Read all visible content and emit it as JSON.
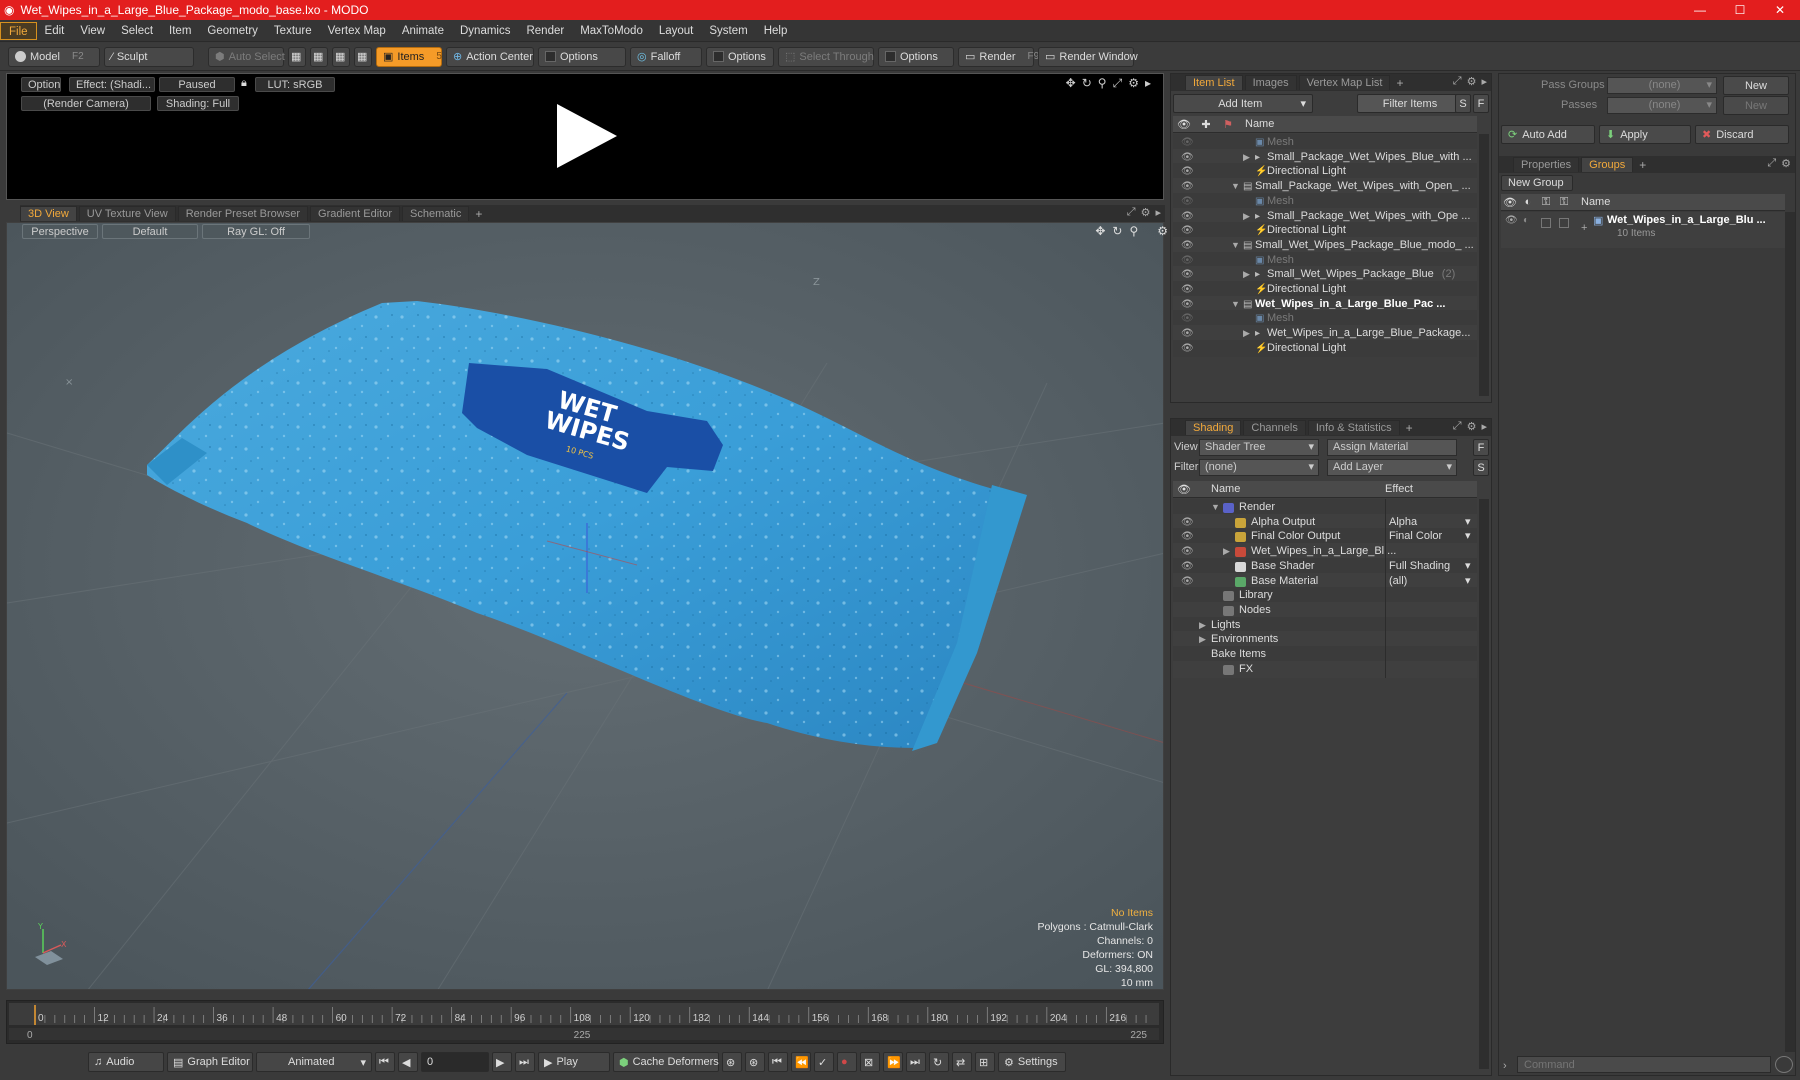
{
  "title": "Wet_Wipes_in_a_Large_Blue_Package_modo_base.lxo - MODO",
  "window_controls": {
    "minimize": "—",
    "maximize": "☐",
    "close": "✕"
  },
  "menu": [
    "File",
    "Edit",
    "View",
    "Select",
    "Item",
    "Geometry",
    "Texture",
    "Vertex Map",
    "Animate",
    "Dynamics",
    "Render",
    "MaxToModo",
    "Layout",
    "System",
    "Help"
  ],
  "toolbar": {
    "model": "Model",
    "model_key": "F2",
    "sculpt": "Sculpt",
    "auto_select": "Auto Select",
    "items": "Items",
    "items_key": "5",
    "action_center": "Action Center",
    "options1": "Options",
    "falloff": "Falloff",
    "options2": "Options",
    "select_through": "Select Through",
    "options3": "Options",
    "render": "Render",
    "render_key": "F9",
    "render_window": "Render Window"
  },
  "render_preview": {
    "options": "Options",
    "effect": "Effect: (Shadi...",
    "paused": "Paused",
    "lut": "LUT: sRGB",
    "camera": "(Render Camera)",
    "shading": "Shading: Full"
  },
  "viewport_tabs": [
    "3D View",
    "UV Texture View",
    "Render Preset Browser",
    "Gradient Editor",
    "Schematic"
  ],
  "viewport": {
    "perspective": "Perspective",
    "default": "Default",
    "raygl": "Ray GL: Off",
    "axis_label": "Z",
    "package_text_1": "WET",
    "package_text_2": "WIPES",
    "package_text_3": "10 PCS",
    "stats": {
      "no_items": "No Items",
      "polygons": "Polygons : Catmull-Clark",
      "channels": "Channels: 0",
      "deformers": "Deformers: ON",
      "gl": "GL: 394,800",
      "unit": "10 mm"
    }
  },
  "timeline": {
    "ticks": [
      "0",
      "12",
      "24",
      "36",
      "48",
      "60",
      "72",
      "84",
      "96",
      "108",
      "120",
      "132",
      "144",
      "156",
      "168",
      "180",
      "192",
      "204",
      "216"
    ],
    "start": "0",
    "mid": "225",
    "end": "225"
  },
  "transport": {
    "audio": "Audio",
    "graph_editor": "Graph Editor",
    "animated": "Animated",
    "frame": "0",
    "play": "Play",
    "cache_deformers": "Cache Deformers",
    "settings": "Settings"
  },
  "item_list": {
    "tabs": [
      "Item List",
      "Images",
      "Vertex Map List"
    ],
    "add_item": "Add Item",
    "filter": "Filter Items",
    "s_btn": "S",
    "f_btn": "F",
    "name_header": "Name",
    "rows": [
      {
        "label": "Mesh",
        "indent": 2,
        "kind": "mesh",
        "dim": true
      },
      {
        "label": "Small_Package_Wet_Wipes_Blue_with ...",
        "indent": 2,
        "kind": "group",
        "arrow": "▶"
      },
      {
        "label": "Directional Light",
        "indent": 2,
        "kind": "light"
      },
      {
        "label": "Small_Package_Wet_Wipes_with_Open_ ...",
        "indent": 1,
        "kind": "scene",
        "arrow": "▼"
      },
      {
        "label": "Mesh",
        "indent": 2,
        "kind": "mesh",
        "dim": true
      },
      {
        "label": "Small_Package_Wet_Wipes_with_Ope ...",
        "indent": 2,
        "kind": "group",
        "arrow": "▶"
      },
      {
        "label": "Directional Light",
        "indent": 2,
        "kind": "light"
      },
      {
        "label": "Small_Wet_Wipes_Package_Blue_modo_ ...",
        "indent": 1,
        "kind": "scene",
        "arrow": "▼"
      },
      {
        "label": "Mesh",
        "indent": 2,
        "kind": "mesh",
        "dim": true
      },
      {
        "label": "Small_Wet_Wipes_Package_Blue",
        "suffix": "(2)",
        "indent": 2,
        "kind": "group",
        "arrow": "▶"
      },
      {
        "label": "Directional Light",
        "indent": 2,
        "kind": "light"
      },
      {
        "label": "Wet_Wipes_in_a_Large_Blue_Pac ...",
        "indent": 1,
        "kind": "scene",
        "arrow": "▼",
        "bold": true
      },
      {
        "label": "Mesh",
        "indent": 2,
        "kind": "mesh",
        "dim": true
      },
      {
        "label": "Wet_Wipes_in_a_Large_Blue_Package...",
        "indent": 2,
        "kind": "group",
        "arrow": "▶"
      },
      {
        "label": "Directional Light",
        "indent": 2,
        "kind": "light"
      }
    ]
  },
  "shading": {
    "tabs": [
      "Shading",
      "Channels",
      "Info & Statistics"
    ],
    "view_label": "View",
    "view_value": "Shader Tree",
    "assign_material": "Assign Material",
    "filter_label": "Filter",
    "filter_value": "(none)",
    "add_layer": "Add Layer",
    "f_btn": "F",
    "s_btn": "S",
    "name_header": "Name",
    "effect_header": "Effect",
    "rows": [
      {
        "label": "Render",
        "effect": "",
        "indent": 1,
        "arrow": "▼",
        "icon": "#5a62c8",
        "eye": false
      },
      {
        "label": "Alpha Output",
        "effect": "Alpha",
        "indent": 2,
        "icon": "#c9a43a",
        "eye": true
      },
      {
        "label": "Final Color Output",
        "effect": "Final Color",
        "indent": 2,
        "icon": "#c9a43a",
        "eye": true
      },
      {
        "label": "Wet_Wipes_in_a_Large_Bl ...",
        "effect": "",
        "indent": 2,
        "arrow": "▶",
        "icon": "#c84a3a",
        "eye": true
      },
      {
        "label": "Base Shader",
        "effect": "Full Shading",
        "indent": 2,
        "icon": "#d8d8d8",
        "eye": true
      },
      {
        "label": "Base Material",
        "effect": "(all)",
        "indent": 2,
        "icon": "#5aa868",
        "eye": true
      },
      {
        "label": "Library",
        "effect": "",
        "indent": 1,
        "icon": "#777",
        "eye": false
      },
      {
        "label": "Nodes",
        "effect": "",
        "indent": 1,
        "icon": "#777",
        "eye": false
      },
      {
        "label": "Lights",
        "effect": "",
        "indent": 0,
        "arrow": "▶",
        "eye": false
      },
      {
        "label": "Environments",
        "effect": "",
        "indent": 0,
        "arrow": "▶",
        "eye": false
      },
      {
        "label": "Bake Items",
        "effect": "",
        "indent": 0,
        "eye": false
      },
      {
        "label": "FX",
        "effect": "",
        "indent": 1,
        "icon": "#777",
        "eye": false
      }
    ]
  },
  "right_panel": {
    "pass_groups_label": "Pass Groups",
    "pass_groups_value": "(none)",
    "new1": "New",
    "passes_label": "Passes",
    "passes_value": "(none)",
    "new2": "New",
    "auto_add": "Auto Add",
    "apply": "Apply",
    "discard": "Discard",
    "tabs": [
      "Properties",
      "Groups"
    ],
    "new_group": "New Group",
    "name_header": "Name",
    "group_name": "Wet_Wipes_in_a_Large_Blu ...",
    "group_count": "10 Items",
    "command_placeholder": "Command"
  }
}
